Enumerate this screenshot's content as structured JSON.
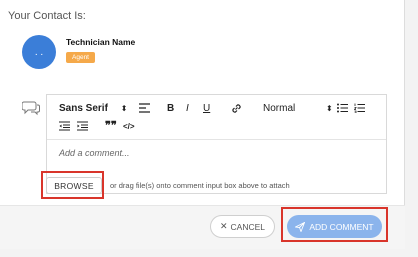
{
  "contact": {
    "title": "Your Contact Is:",
    "avatar_text": ". .",
    "name": "Technician Name",
    "badge": "Agent"
  },
  "editor": {
    "font_family": "Sans Serif",
    "font_size": "Normal",
    "bold": "B",
    "italic": "I",
    "underline": "U",
    "placeholder": "Add a comment..."
  },
  "attach": {
    "browse_label": "BROWSE",
    "hint": "or drag file(s) onto comment input box above to attach"
  },
  "footer": {
    "cancel_label": "CANCEL",
    "add_label": "ADD COMMENT"
  },
  "colors": {
    "avatar": "#3b7ed8",
    "badge": "#f5a94a",
    "primary_button": "#8bb4ec",
    "highlight": "#d9352b"
  },
  "icons": [
    "comment-icon",
    "align-icon",
    "link-icon",
    "bullet-list-icon",
    "ordered-list-icon",
    "indent-decrease-icon",
    "indent-increase-icon",
    "blockquote-icon",
    "code-icon",
    "close-icon",
    "send-icon"
  ]
}
